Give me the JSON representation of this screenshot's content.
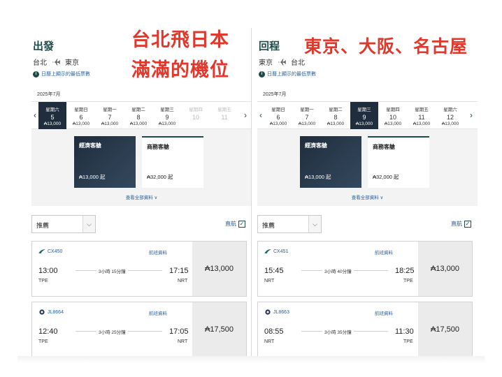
{
  "outbound": {
    "title": "出發",
    "route_from": "台北",
    "route_to": "東京",
    "note": "日曆上顯示的最低票數",
    "month": "2025年7月",
    "dates": [
      {
        "dow": "星期六",
        "day": "5",
        "price": "₳13,000",
        "state": "selected"
      },
      {
        "dow": "星期日",
        "day": "6",
        "price": "₳13,000",
        "state": "normal"
      },
      {
        "dow": "星期一",
        "day": "7",
        "price": "₳13,000",
        "state": "normal"
      },
      {
        "dow": "星期二",
        "day": "8",
        "price": "₳13,000",
        "state": "normal"
      },
      {
        "dow": "星期三",
        "day": "9",
        "price": "₳13,000",
        "state": "normal"
      },
      {
        "dow": "星期四",
        "day": "10",
        "price": "",
        "state": "disabled"
      },
      {
        "dow": "星期五",
        "day": "11",
        "price": "",
        "state": "disabled"
      }
    ],
    "cabins": [
      {
        "name": "經濟客艙",
        "price": "₳13,000 起"
      },
      {
        "name": "商務客艙",
        "price": "₳32,000 起"
      }
    ],
    "see_all": "查看全部資料 ∨",
    "sort": "推薦",
    "direct": "直航",
    "flights": [
      {
        "airline_icon": "cathay-icon",
        "number": "CX450",
        "info": "航班資料",
        "dep_time": "13:00",
        "arr_time": "17:15",
        "dep_airport": "TPE",
        "arr_airport": "NRT",
        "duration": "3小時 15分鐘",
        "price": "₳13,000"
      },
      {
        "airline_icon": "jal-icon",
        "number": "JL8664",
        "info": "航班資料",
        "dep_time": "12:40",
        "arr_time": "17:05",
        "dep_airport": "TPE",
        "arr_airport": "NRT",
        "duration": "3小時 25分鐘",
        "price": "₳17,500"
      }
    ]
  },
  "return": {
    "title": "回程",
    "route_from": "東京",
    "route_to": "台北",
    "note": "日曆上顯示的最低票數",
    "month": "2025年7月",
    "dates": [
      {
        "dow": "星期日",
        "day": "6",
        "price": "₳13,000",
        "state": "normal"
      },
      {
        "dow": "星期一",
        "day": "7",
        "price": "₳13,000",
        "state": "normal"
      },
      {
        "dow": "星期二",
        "day": "8",
        "price": "₳13,000",
        "state": "normal"
      },
      {
        "dow": "星期三",
        "day": "9",
        "price": "₳13,000",
        "state": "selected"
      },
      {
        "dow": "星期四",
        "day": "10",
        "price": "₳13,000",
        "state": "normal"
      },
      {
        "dow": "星期五",
        "day": "11",
        "price": "₳13,000",
        "state": "normal"
      },
      {
        "dow": "星期六",
        "day": "12",
        "price": "₳13,000",
        "state": "normal"
      }
    ],
    "cabins": [
      {
        "name": "經濟客艙",
        "price": "₳13,000 起"
      },
      {
        "name": "商務客艙",
        "price": "₳32,000 起"
      }
    ],
    "see_all": "查看全部資料 ∨",
    "sort": "推薦",
    "direct": "直航",
    "flights": [
      {
        "airline_icon": "cathay-icon",
        "number": "CX451",
        "info": "航班資料",
        "dep_time": "15:45",
        "arr_time": "18:25",
        "dep_airport": "NRT",
        "arr_airport": "TPE",
        "duration": "3小時 40分鐘",
        "price": "₳13,000"
      },
      {
        "airline_icon": "jal-icon",
        "number": "JL8663",
        "info": "航班資料",
        "dep_time": "08:55",
        "arr_time": "11:30",
        "dep_airport": "NRT",
        "arr_airport": "TPE",
        "duration": "3小時 35分鐘",
        "price": "₳17,500"
      }
    ]
  },
  "annotations": {
    "left_line1": "台北飛日本",
    "left_line2": "滿滿的機位",
    "right_line1": "東京、大阪、名古屋"
  },
  "colors": {
    "accent": "#1d4b4a",
    "selected_date": "#1f2d3d",
    "link": "#2a5f9e",
    "annotation": "#e0382c"
  }
}
